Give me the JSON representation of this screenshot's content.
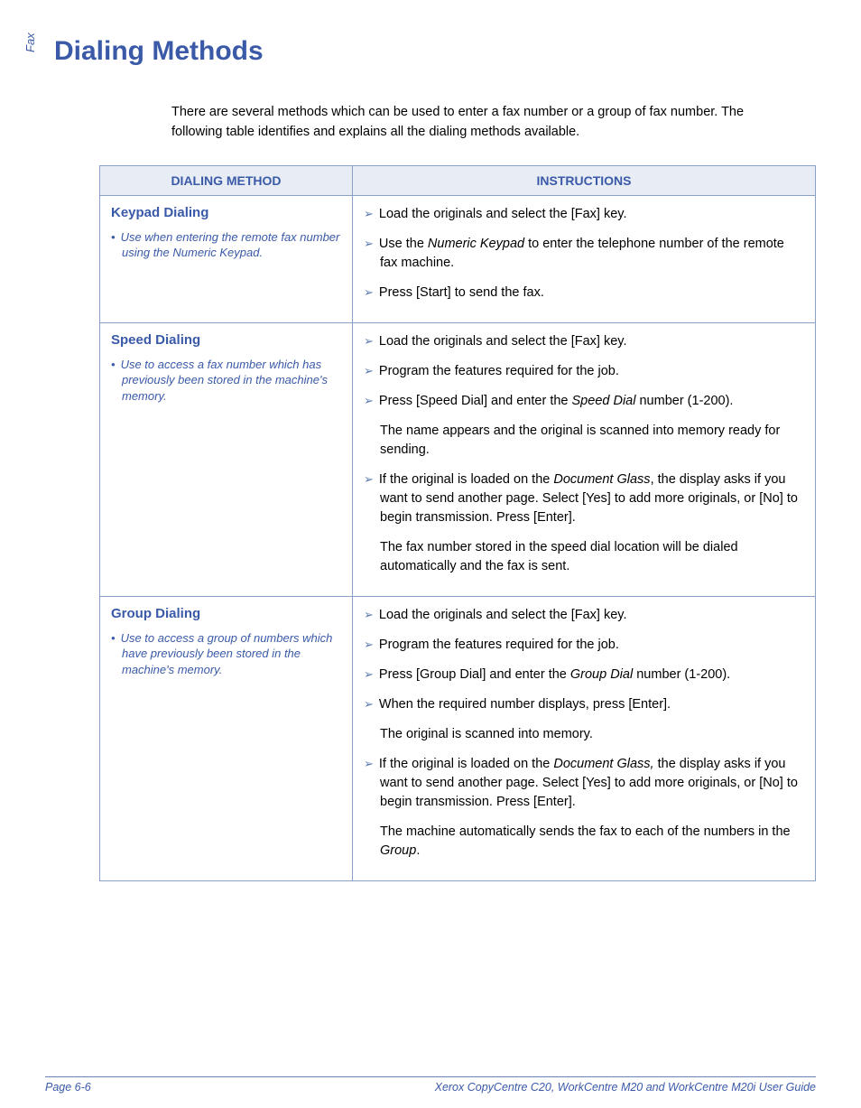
{
  "side_label": "Fax",
  "title": "Dialing Methods",
  "intro": "There are several methods which can be used to enter a fax number or a group of fax number. The following table identifies and explains all the dialing methods available.",
  "headers": {
    "method": "DIALING METHOD",
    "instructions": "INSTRUCTIONS"
  },
  "rows": [
    {
      "method_title": "Keypad Dialing",
      "method_desc": "Use when entering the remote fax number using the Numeric Keypad.",
      "instructions": [
        {
          "type": "bullet",
          "html": "Load the originals and select the [Fax] key."
        },
        {
          "type": "bullet",
          "html": "Use the <em>Numeric Keypad</em> to enter the telephone number of the remote fax machine."
        },
        {
          "type": "bullet",
          "html": "Press [Start] to send the fax."
        }
      ]
    },
    {
      "method_title": "Speed Dialing",
      "method_desc": "Use to access a fax number which has previously been stored in the machine's memory.",
      "instructions": [
        {
          "type": "bullet",
          "html": "Load the originals and select the [Fax] key."
        },
        {
          "type": "bullet",
          "html": "Program the features required for the job."
        },
        {
          "type": "bullet",
          "html": "Press [Speed Dial] and enter the <em>Speed Dial</em> number (1-200)."
        },
        {
          "type": "plain",
          "html": "The name appears and the original is scanned into memory ready for sending."
        },
        {
          "type": "bullet",
          "html": "If the original is loaded on the <em>Document Glass</em>, the display asks if you want to send another page. Select [Yes] to add more originals, or [No] to begin transmission. Press [Enter]."
        },
        {
          "type": "plain",
          "html": "The fax number stored in the speed dial location will be dialed automatically and the fax is sent."
        }
      ]
    },
    {
      "method_title": "Group Dialing",
      "method_desc": "Use to access a group of numbers which have previously been stored in the machine's memory.",
      "instructions": [
        {
          "type": "bullet",
          "html": "Load the originals and select the [Fax] key."
        },
        {
          "type": "bullet",
          "html": "Program the features required for the job."
        },
        {
          "type": "bullet",
          "html": "Press [Group Dial] and enter the <em>Group Dial</em> number (1-200)."
        },
        {
          "type": "bullet",
          "html": "When the required number displays, press [Enter]."
        },
        {
          "type": "plain",
          "html": "The original is scanned into memory."
        },
        {
          "type": "bullet",
          "html": "If the original is loaded on the <em>Document Glass,</em> the display asks if you want to send another page. Select [Yes] to add more originals, or [No] to begin transmission. Press [Enter]."
        },
        {
          "type": "plain",
          "html": "The machine automatically sends the fax to each of the numbers in the <em>Group</em>."
        }
      ]
    }
  ],
  "footer": {
    "left": "Page 6-6",
    "right": "Xerox CopyCentre C20, WorkCentre M20 and WorkCentre M20i User Guide"
  }
}
